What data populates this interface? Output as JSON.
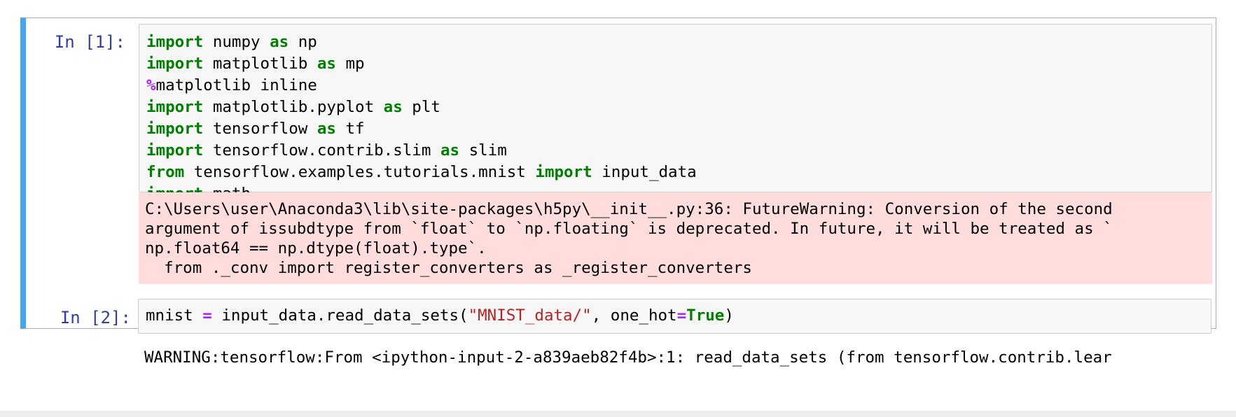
{
  "cells": [
    {
      "prompt": "In [1]:",
      "code": {
        "l1": [
          "import",
          " numpy ",
          "as",
          " np"
        ],
        "l2": [
          "import",
          " matplotlib ",
          "as",
          " mp"
        ],
        "l3": [
          "%",
          "matplotlib inline"
        ],
        "l4": [
          "import",
          " matplotlib.pyplot ",
          "as",
          " plt"
        ],
        "l5": [
          "import",
          " tensorflow ",
          "as",
          " tf"
        ],
        "l6": [
          "import",
          " tensorflow.contrib.slim ",
          "as",
          " slim"
        ],
        "l7": [
          "from",
          " tensorflow.examples.tutorials.mnist ",
          "import",
          " input_data"
        ],
        "l8": [
          "import",
          " math"
        ]
      },
      "stderr": [
        "C:\\Users\\user\\Anaconda3\\lib\\site-packages\\h5py\\__init__.py:36: FutureWarning: Conversion of the second",
        "argument of issubdtype from `float` to `np.floating` is deprecated. In future, it will be treated as `",
        "np.float64 == np.dtype(float).type`.",
        "  from ._conv import register_converters as _register_converters"
      ]
    },
    {
      "prompt": "In [2]:",
      "code": {
        "p1": "mnist ",
        "p2": "=",
        "p3": " input_data.read_data_sets(",
        "p4": "\"MNIST_data/\"",
        "p5": ", one_hot",
        "p6": "=",
        "p7": "True",
        "p8": ")"
      },
      "output": [
        "WARNING:tensorflow:From <ipython-input-2-a839aeb82f4b>:1: read_data_sets (from tensorflow.contrib.lear"
      ]
    }
  ]
}
